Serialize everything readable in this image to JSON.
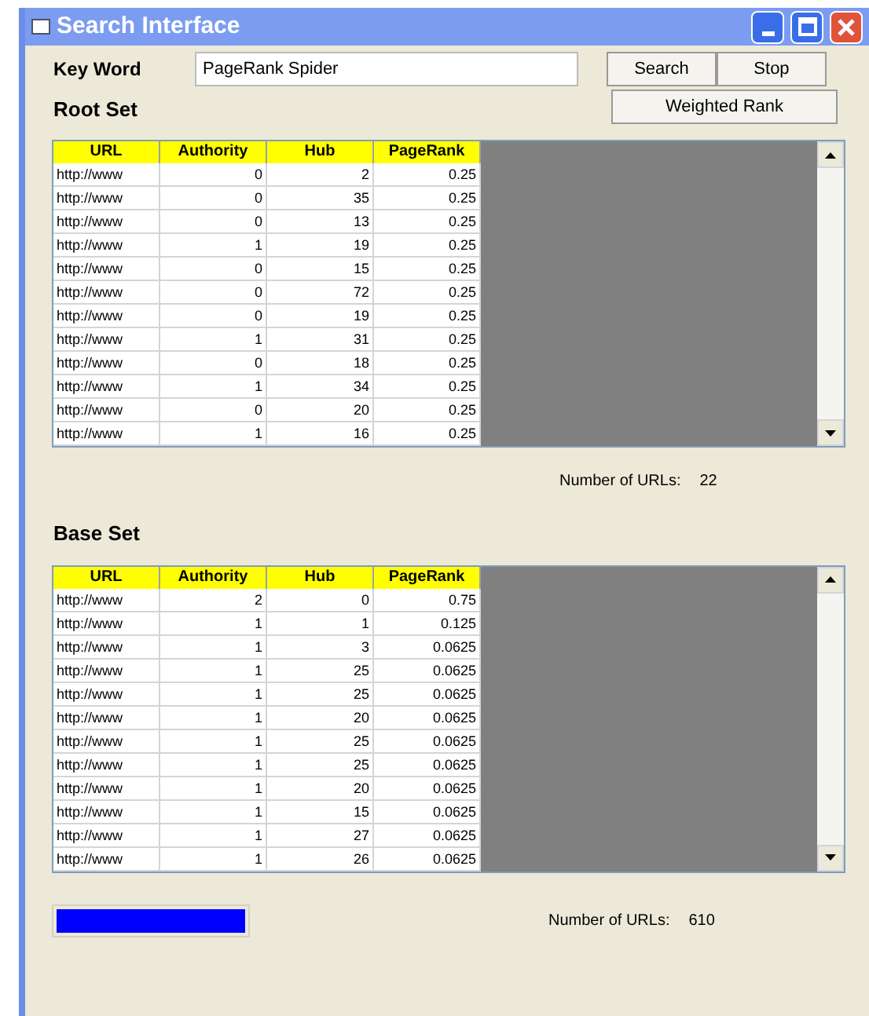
{
  "window": {
    "title": "Search Interface"
  },
  "keyword": {
    "label": "Key Word",
    "value": "PageRank Spider"
  },
  "buttons": [
    {
      "label": "Search"
    },
    {
      "label": "Stop"
    }
  ],
  "weighted_button": {
    "label": "Weighted Rank"
  },
  "root_set": {
    "title": "Root Set",
    "columns": [
      "URL",
      "Authority",
      "Hub",
      "PageRank"
    ],
    "rows": [
      [
        "http://www",
        "0",
        "2",
        "0.25"
      ],
      [
        "http://www",
        "0",
        "35",
        "0.25"
      ],
      [
        "http://www",
        "0",
        "13",
        "0.25"
      ],
      [
        "http://www",
        "1",
        "19",
        "0.25"
      ],
      [
        "http://www",
        "0",
        "15",
        "0.25"
      ],
      [
        "http://www",
        "0",
        "72",
        "0.25"
      ],
      [
        "http://www",
        "0",
        "19",
        "0.25"
      ],
      [
        "http://www",
        "1",
        "31",
        "0.25"
      ],
      [
        "http://www",
        "0",
        "18",
        "0.25"
      ],
      [
        "http://www",
        "1",
        "34",
        "0.25"
      ],
      [
        "http://www",
        "0",
        "20",
        "0.25"
      ],
      [
        "http://www",
        "1",
        "16",
        "0.25"
      ]
    ],
    "count_label": "Number of URLs:",
    "count": "22"
  },
  "base_set": {
    "title": "Base Set",
    "columns": [
      "URL",
      "Authority",
      "Hub",
      "PageRank"
    ],
    "rows": [
      [
        "http://www",
        "2",
        "0",
        "0.75"
      ],
      [
        "http://www",
        "1",
        "1",
        "0.125"
      ],
      [
        "http://www",
        "1",
        "3",
        "0.0625"
      ],
      [
        "http://www",
        "1",
        "25",
        "0.0625"
      ],
      [
        "http://www",
        "1",
        "25",
        "0.0625"
      ],
      [
        "http://www",
        "1",
        "20",
        "0.0625"
      ],
      [
        "http://www",
        "1",
        "25",
        "0.0625"
      ],
      [
        "http://www",
        "1",
        "25",
        "0.0625"
      ],
      [
        "http://www",
        "1",
        "20",
        "0.0625"
      ],
      [
        "http://www",
        "1",
        "15",
        "0.0625"
      ],
      [
        "http://www",
        "1",
        "27",
        "0.0625"
      ],
      [
        "http://www",
        "1",
        "26",
        "0.0625"
      ]
    ],
    "count_label": "Number of URLs:",
    "count": "610"
  },
  "progress": {
    "level": 1
  }
}
